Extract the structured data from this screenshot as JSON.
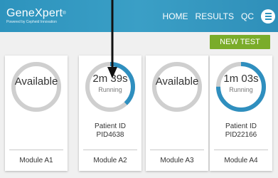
{
  "header": {
    "brand_name": "GeneXpert",
    "brand_mark": "®",
    "brand_tagline": "Powered by Cepheid Innovation",
    "nav": [
      "HOME",
      "RESULTS",
      "QC"
    ],
    "menu_icon": "menu-icon"
  },
  "actions": {
    "new_test_label": "NEW TEST"
  },
  "modules": [
    {
      "name": "Module A1",
      "status": "Available",
      "sub": "",
      "patient_label": "",
      "patient_id": "",
      "progress": 0
    },
    {
      "name": "Module A2",
      "status": "2m 39s",
      "sub": "Running",
      "patient_label": "Patient ID",
      "patient_id": "PID4638",
      "progress": 0.38
    },
    {
      "name": "Module A3",
      "status": "Available",
      "sub": "",
      "patient_label": "",
      "patient_id": "",
      "progress": 0
    },
    {
      "name": "Module A4",
      "status": "1m 03s",
      "sub": "Running",
      "patient_label": "Patient ID",
      "patient_id": "PID22166",
      "progress": 0.75
    }
  ],
  "colors": {
    "header_blue": "#2d93bd",
    "ring_track": "#cfcfcf",
    "ring_progress": "#2f8fbf",
    "new_test_green": "#7aac2a"
  },
  "annotation": {
    "arrow_icon": "down-arrow-icon"
  }
}
